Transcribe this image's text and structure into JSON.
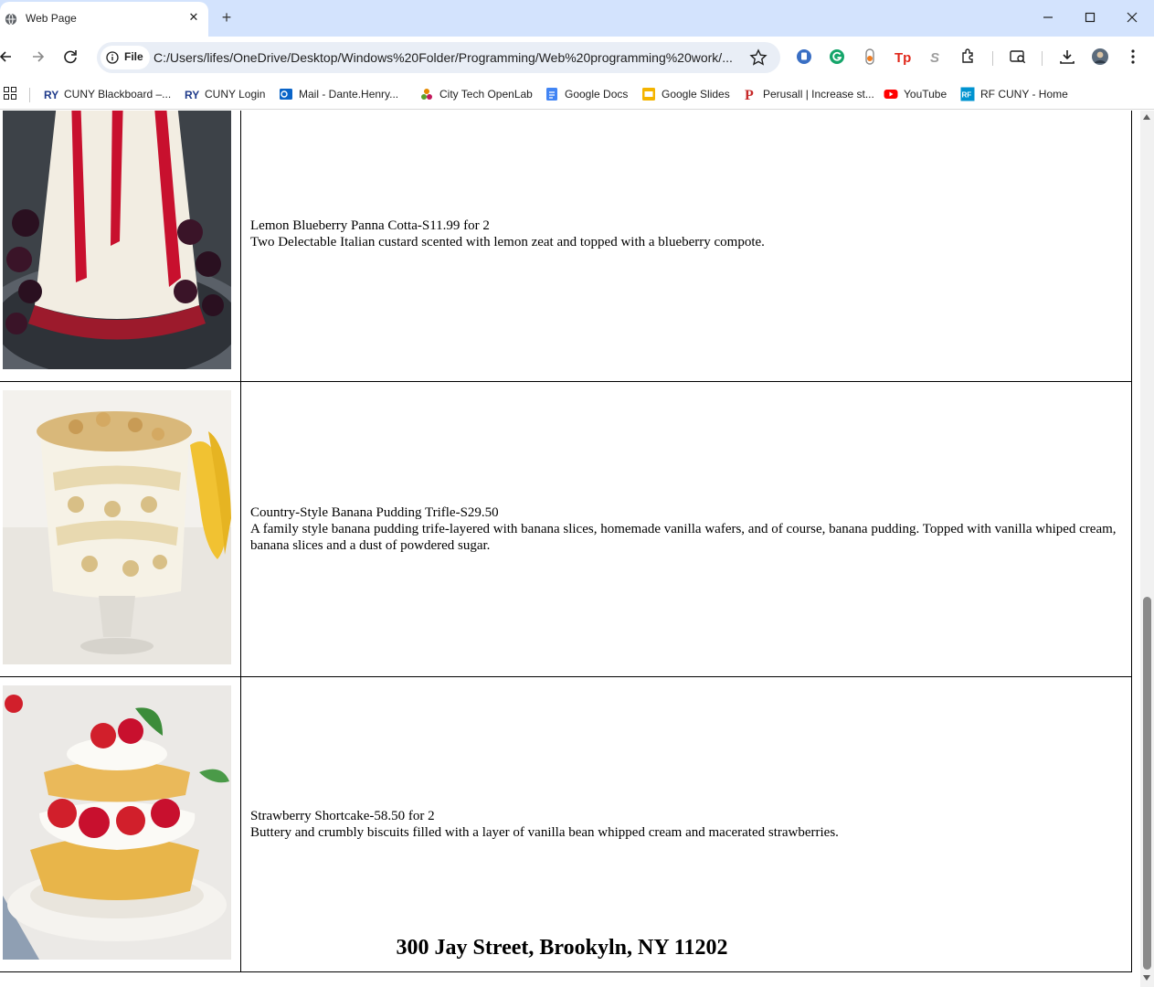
{
  "browser": {
    "tab_title": "Web Page",
    "new_tab_glyph": "+",
    "close_glyph": "✕",
    "chip_label": "File",
    "url": "C:/Users/lifes/OneDrive/Desktop/Windows%20Folder/Programming/Web%20programming%20work/...",
    "icons": [
      "globe-icon",
      "minimize-icon",
      "maximize-icon",
      "close-icon",
      "back-icon",
      "forward-icon",
      "reload-icon",
      "info-icon",
      "star-icon",
      "extension-icon",
      "download-icon",
      "menu-icon"
    ]
  },
  "bookmarks": [
    {
      "label": "CUNY Blackboard –...",
      "icon": "cuny-icon",
      "color": "#1e3a8a"
    },
    {
      "label": "CUNY Login",
      "icon": "cuny-icon",
      "color": "#1e3a8a"
    },
    {
      "label": "Mail - Dante.Henry...",
      "icon": "outlook-icon",
      "color": "#0a64c8"
    },
    {
      "label": "City Tech OpenLab",
      "icon": "openlab-icon",
      "color": "#e58a00"
    },
    {
      "label": "Google Docs",
      "icon": "docs-icon",
      "color": "#4285f4"
    },
    {
      "label": "Google Slides",
      "icon": "slides-icon",
      "color": "#f4b400"
    },
    {
      "label": "Perusall | Increase st...",
      "icon": "perusall-icon",
      "color": "#c62828"
    },
    {
      "label": "YouTube",
      "icon": "youtube-icon",
      "color": "#ff0000"
    },
    {
      "label": "RF CUNY - Home",
      "icon": "rf-icon",
      "color": "#0093d0"
    }
  ],
  "menu_items": [
    {
      "title": "Lemon Blueberry Panna Cotta-S11.99 for 2",
      "description": "Two Delectable Italian custard scented with lemon zeat and topped with a blueberry compote.",
      "image": "panna-cotta-photo"
    },
    {
      "title": "Country-Style Banana Pudding Trifle-S29.50",
      "description": "A family style banana pudding trife-layered with banana slices, homemade vanilla wafers, and of course, banana pudding. Topped with vanilla whiped cream, banana slices and a dust of powdered sugar.",
      "image": "banana-pudding-photo"
    },
    {
      "title": "Strawberry Shortcake-58.50 for 2",
      "description": "Buttery and crumbly biscuits filled with a layer of vanilla bean whipped cream and macerated strawberries.",
      "image": "strawberry-shortcake-photo"
    }
  ],
  "footer": {
    "address": "300 Jay Street, Brookyln, NY 11202"
  },
  "colors": {
    "tabstrip": "#d3e3fd",
    "omnibox": "#e9eef6"
  }
}
